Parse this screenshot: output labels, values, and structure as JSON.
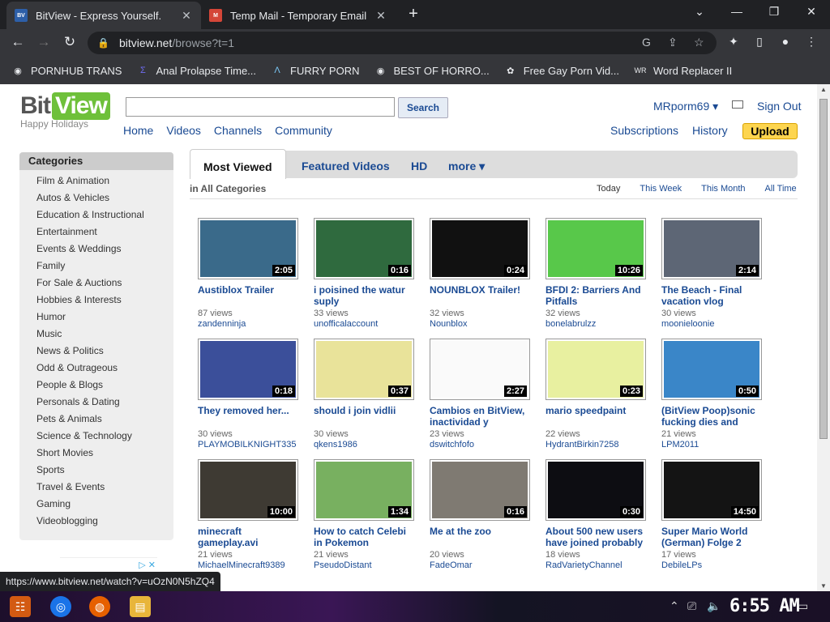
{
  "browser": {
    "tabs": [
      {
        "title": "BitView - Express Yourself.",
        "favicon": "BV",
        "active": true
      },
      {
        "title": "Temp Mail - Temporary Email",
        "favicon": "M",
        "active": false
      }
    ],
    "url_host": "bitview.net",
    "url_path": "/browse?t=1",
    "bookmarks": [
      "PORNHUB TRANS",
      "Anal Prolapse Time...",
      "FURRY PORN",
      "BEST OF HORRO...",
      "Free Gay Porn Vid...",
      "Word Replacer II"
    ],
    "status_url": "https://www.bitview.net/watch?v=uOzN0N5hZQ4"
  },
  "site": {
    "logo_bit": "Bit",
    "logo_view": "View",
    "logo_tagline": "Happy Holidays",
    "search_button": "Search",
    "search_value": "",
    "nav": [
      "Home",
      "Videos",
      "Channels",
      "Community"
    ],
    "username": "MRporm69 ▾",
    "sign_out": "Sign Out",
    "subnav": [
      "Subscriptions",
      "History"
    ],
    "upload": "Upload"
  },
  "categories": {
    "header": "Categories",
    "items": [
      "Film & Animation",
      "Autos & Vehicles",
      "Education & Instructional",
      "Entertainment",
      "Events & Weddings",
      "Family",
      "For Sale & Auctions",
      "Hobbies & Interests",
      "Humor",
      "Music",
      "News & Politics",
      "Odd & Outrageous",
      "People & Blogs",
      "Personals & Dating",
      "Pets & Animals",
      "Science & Technology",
      "Short Movies",
      "Sports",
      "Travel & Events",
      "Gaming",
      "Videoblogging"
    ]
  },
  "browse": {
    "tabs": [
      "Most Viewed",
      "Featured Videos",
      "HD",
      "more ▾"
    ],
    "in_category": "in All Categories",
    "time_filters": [
      "Today",
      "This Week",
      "This Month",
      "All Time"
    ],
    "videos": [
      {
        "title": "Austiblox Trailer",
        "views": "87 views",
        "user": "zandenninja",
        "duration": "2:05",
        "bg": "#3a6a8a"
      },
      {
        "title": "i poisined the watur suply",
        "views": "33 views",
        "user": "unofficalaccount",
        "duration": "0:16",
        "bg": "#2f6a3e"
      },
      {
        "title": "NOUNBLOX Trailer!",
        "views": "32 views",
        "user": "Nounblox",
        "duration": "0:24",
        "bg": "#111"
      },
      {
        "title": "BFDI 2: Barriers And Pitfalls",
        "views": "32 views",
        "user": "bonelabrulzz",
        "duration": "10:26",
        "bg": "#58c84a"
      },
      {
        "title": "The Beach - Final vacation vlog",
        "views": "30 views",
        "user": "moonieloonie",
        "duration": "2:14",
        "bg": "#5d6675"
      },
      {
        "title": "They removed her...",
        "views": "30 views",
        "user": "PLAYMOBILKNIGHT335",
        "duration": "0:18",
        "bg": "#3b4f9a"
      },
      {
        "title": "should i join vidlii",
        "views": "30 views",
        "user": "qkens1986",
        "duration": "0:37",
        "bg": "#e9e39a"
      },
      {
        "title": "Cambios en BitView, inactividad y",
        "views": "23 views",
        "user": "dswitchfofo",
        "duration": "2:27",
        "bg": "#fafafa"
      },
      {
        "title": "mario speedpaint",
        "views": "22 views",
        "user": "HydrantBirkin7258",
        "duration": "0:23",
        "bg": "#e8f0a0"
      },
      {
        "title": "(BitView Poop)sonic fucking dies and",
        "views": "21 views",
        "user": "LPM2011",
        "duration": "0:50",
        "bg": "#3a86c8"
      },
      {
        "title": "minecraft gameplay.avi",
        "views": "21 views",
        "user": "MichaelMinecraft9389",
        "duration": "10:00",
        "bg": "#3e3a33"
      },
      {
        "title": "How to catch Celebi in Pokemon",
        "views": "21 views",
        "user": "PseudoDistant",
        "duration": "1:34",
        "bg": "#78b060"
      },
      {
        "title": "Me at the zoo",
        "views": "20 views",
        "user": "FadeOmar",
        "duration": "0:16",
        "bg": "#7f7a72"
      },
      {
        "title": "About 500 new users have joined probably",
        "views": "18 views",
        "user": "RadVarietyChannel",
        "duration": "0:30",
        "bg": "#0d0d12"
      },
      {
        "title": "Super Mario World (German) Folge 2",
        "views": "17 views",
        "user": "DebileLPs",
        "duration": "14:50",
        "bg": "#141414"
      }
    ]
  },
  "taskbar": {
    "clock": "6:55 AM"
  }
}
